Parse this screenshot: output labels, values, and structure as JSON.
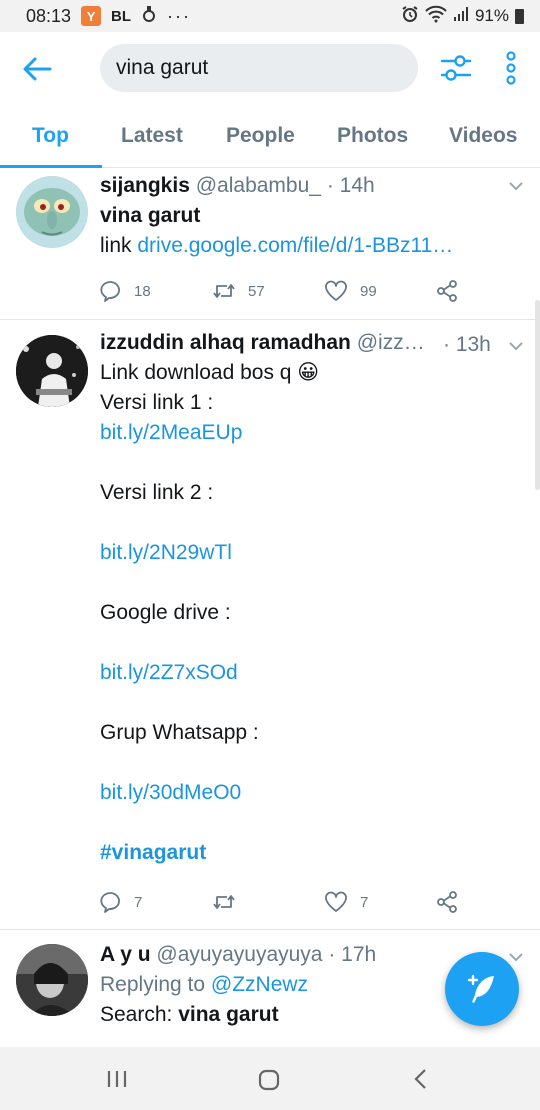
{
  "status_bar": {
    "time": "08:13",
    "badge_letter": "Y",
    "carrier": "BL",
    "dots": "···",
    "battery": "91%"
  },
  "search": {
    "query": "vina garut"
  },
  "tabs": [
    {
      "label": "Top"
    },
    {
      "label": "Latest"
    },
    {
      "label": "People"
    },
    {
      "label": "Photos"
    },
    {
      "label": "Videos"
    }
  ],
  "tweets": [
    {
      "name": "sijangkis",
      "handle": "@alabambu_",
      "time": "· 14h",
      "text_bold": "vina garut",
      "link_prefix": "link ",
      "link_text": "drive.google.com/file/d/1-BBz11…",
      "replies": "18",
      "retweets": "57",
      "likes": "99"
    },
    {
      "name": "izzuddin alhaq ramadhan",
      "handle": "@izz…",
      "time": "· 13h",
      "line1": "Link download bos q 😀",
      "line2": "Versi link 1 :",
      "link1": "bit.ly/2MeaEUp",
      "line3": "Versi link 2 :",
      "link2": "bit.ly/2N29wTl",
      "line4": "Google drive :",
      "link3": "bit.ly/2Z7xSOd",
      "line5": "Grup Whatsapp :",
      "link4": "bit.ly/30dMeO0",
      "hashtag": "#vinagarut",
      "replies": "7",
      "retweets": "",
      "likes": "7"
    },
    {
      "name": "A y u",
      "handle": "@ayuyayuyayuya",
      "time": "· 17h",
      "reply_prefix": "Replying to ",
      "reply_to": "@ZzNewz",
      "search_label": "Search: ",
      "search_term": "vina garut"
    }
  ],
  "colors": {
    "accent": "#1da1f2",
    "link": "#1b95e0",
    "muted": "#657786"
  }
}
